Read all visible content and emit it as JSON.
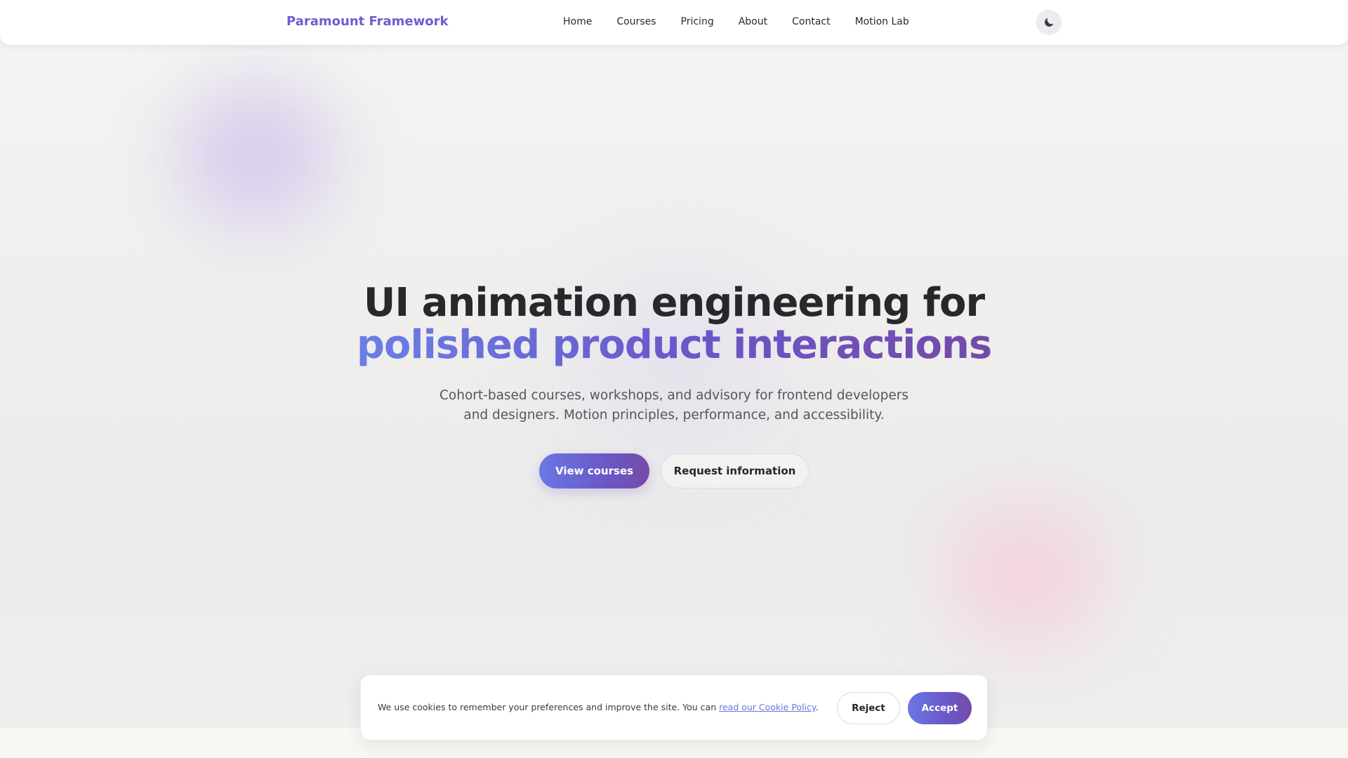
{
  "brand": {
    "name": "Paramount Framework",
    "color": "#6a5fd0"
  },
  "nav": {
    "items": [
      {
        "label": "Home"
      },
      {
        "label": "Courses"
      },
      {
        "label": "Pricing"
      },
      {
        "label": "About"
      },
      {
        "label": "Contact"
      },
      {
        "label": "Motion Lab"
      }
    ],
    "theme_toggle_icon": "moon-icon"
  },
  "hero": {
    "headline_line1": "UI animation engineering for",
    "headline_line2": "polished product interactions",
    "subtitle_line1": "Cohort-based courses, workshops, and advisory for frontend developers",
    "subtitle_line2": "and designers. Motion principles, performance, and accessibility.",
    "primary_cta": "View courses",
    "secondary_cta": "Request information",
    "accent_gradient": [
      "#6b7fe6",
      "#6a55c8",
      "#744aa8"
    ]
  },
  "cookie_banner": {
    "text": "We use cookies to remember your preferences and improve the site. You can ",
    "link_text": "read our Cookie Policy",
    "text_after": ".",
    "reject_label": "Reject",
    "accept_label": "Accept"
  }
}
